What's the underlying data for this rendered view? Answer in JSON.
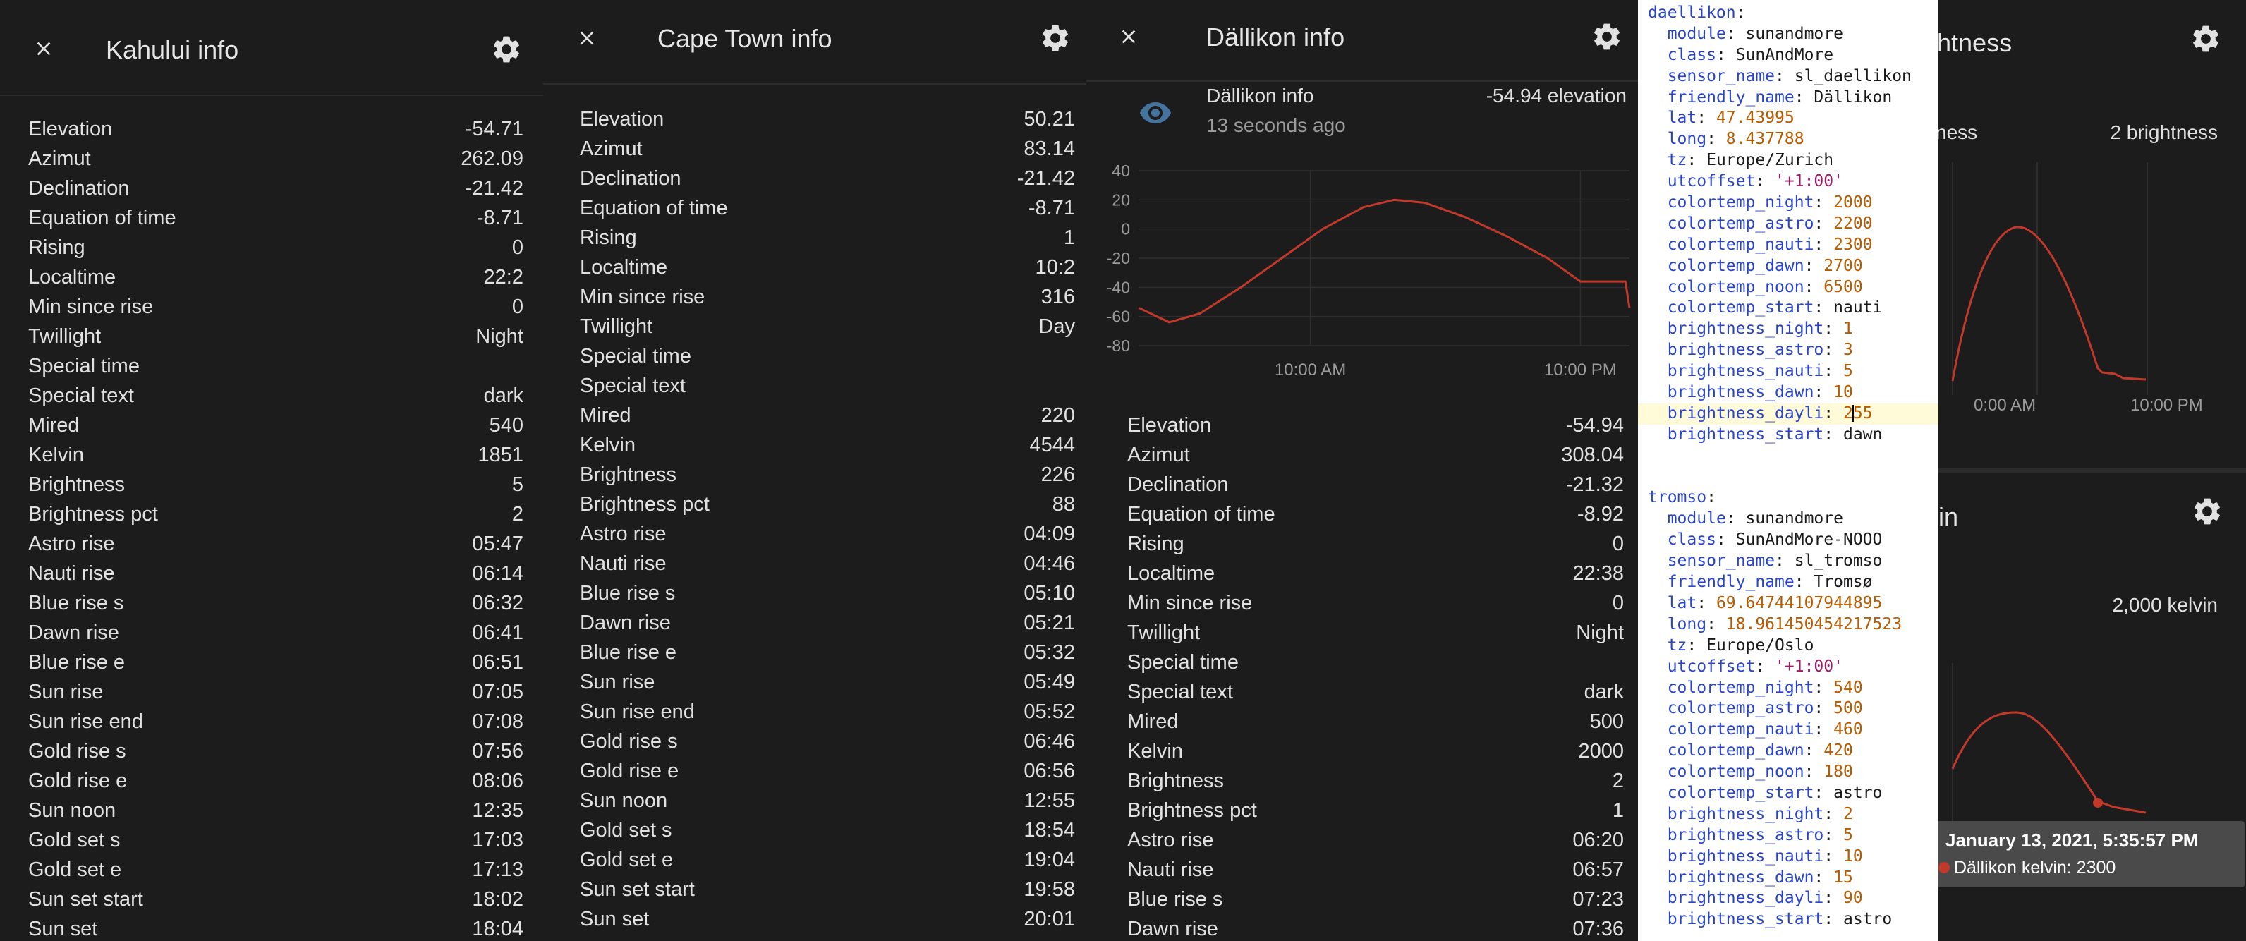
{
  "kahului": {
    "title": "Kahului info",
    "rows": [
      {
        "label": "Elevation",
        "value": "-54.71"
      },
      {
        "label": "Azimut",
        "value": "262.09"
      },
      {
        "label": "Declination",
        "value": "-21.42"
      },
      {
        "label": "Equation of time",
        "value": "-8.71"
      },
      {
        "label": "Rising",
        "value": "0"
      },
      {
        "label": "Localtime",
        "value": "22:2"
      },
      {
        "label": "Min since rise",
        "value": "0"
      },
      {
        "label": "Twillight",
        "value": "Night"
      },
      {
        "label": "Special time",
        "value": ""
      },
      {
        "label": "Special text",
        "value": "dark"
      },
      {
        "label": "Mired",
        "value": "540"
      },
      {
        "label": "Kelvin",
        "value": "1851"
      },
      {
        "label": "Brightness",
        "value": "5"
      },
      {
        "label": "Brightness pct",
        "value": "2"
      },
      {
        "label": "Astro rise",
        "value": "05:47"
      },
      {
        "label": "Nauti rise",
        "value": "06:14"
      },
      {
        "label": "Blue rise s",
        "value": "06:32"
      },
      {
        "label": "Dawn rise",
        "value": "06:41"
      },
      {
        "label": "Blue rise e",
        "value": "06:51"
      },
      {
        "label": "Sun rise",
        "value": "07:05"
      },
      {
        "label": "Sun rise end",
        "value": "07:08"
      },
      {
        "label": "Gold rise s",
        "value": "07:56"
      },
      {
        "label": "Gold rise e",
        "value": "08:06"
      },
      {
        "label": "Sun noon",
        "value": "12:35"
      },
      {
        "label": "Gold set s",
        "value": "17:03"
      },
      {
        "label": "Gold set e",
        "value": "17:13"
      },
      {
        "label": "Sun set start",
        "value": "18:02"
      },
      {
        "label": "Sun set",
        "value": "18:04"
      }
    ]
  },
  "capetown": {
    "title": "Cape Town info",
    "rows": [
      {
        "label": "Elevation",
        "value": "50.21"
      },
      {
        "label": "Azimut",
        "value": "83.14"
      },
      {
        "label": "Declination",
        "value": "-21.42"
      },
      {
        "label": "Equation of time",
        "value": "-8.71"
      },
      {
        "label": "Rising",
        "value": "1"
      },
      {
        "label": "Localtime",
        "value": "10:2"
      },
      {
        "label": "Min since rise",
        "value": "316"
      },
      {
        "label": "Twillight",
        "value": "Day"
      },
      {
        "label": "Special time",
        "value": ""
      },
      {
        "label": "Special text",
        "value": ""
      },
      {
        "label": "Mired",
        "value": "220"
      },
      {
        "label": "Kelvin",
        "value": "4544"
      },
      {
        "label": "Brightness",
        "value": "226"
      },
      {
        "label": "Brightness pct",
        "value": "88"
      },
      {
        "label": "Astro rise",
        "value": "04:09"
      },
      {
        "label": "Nauti rise",
        "value": "04:46"
      },
      {
        "label": "Blue rise s",
        "value": "05:10"
      },
      {
        "label": "Dawn rise",
        "value": "05:21"
      },
      {
        "label": "Blue rise e",
        "value": "05:32"
      },
      {
        "label": "Sun rise",
        "value": "05:49"
      },
      {
        "label": "Sun rise end",
        "value": "05:52"
      },
      {
        "label": "Gold rise s",
        "value": "06:46"
      },
      {
        "label": "Gold rise e",
        "value": "06:56"
      },
      {
        "label": "Sun noon",
        "value": "12:55"
      },
      {
        "label": "Gold set s",
        "value": "18:54"
      },
      {
        "label": "Gold set e",
        "value": "19:04"
      },
      {
        "label": "Sun set start",
        "value": "19:58"
      },
      {
        "label": "Sun set",
        "value": "20:01"
      }
    ]
  },
  "dallikon": {
    "title": "Dällikon info",
    "history": {
      "entity_name": "Dällikon info",
      "state": "-54.94 elevation",
      "last_changed": "13 seconds ago"
    },
    "rows": [
      {
        "label": "Elevation",
        "value": "-54.94"
      },
      {
        "label": "Azimut",
        "value": "308.04"
      },
      {
        "label": "Declination",
        "value": "-21.32"
      },
      {
        "label": "Equation of time",
        "value": "-8.92"
      },
      {
        "label": "Rising",
        "value": "0"
      },
      {
        "label": "Localtime",
        "value": "22:38"
      },
      {
        "label": "Min since rise",
        "value": "0"
      },
      {
        "label": "Twillight",
        "value": "Night"
      },
      {
        "label": "Special time",
        "value": ""
      },
      {
        "label": "Special text",
        "value": "dark"
      },
      {
        "label": "Mired",
        "value": "500"
      },
      {
        "label": "Kelvin",
        "value": "2000"
      },
      {
        "label": "Brightness",
        "value": "2"
      },
      {
        "label": "Brightness pct",
        "value": "1"
      },
      {
        "label": "Astro rise",
        "value": "06:20"
      },
      {
        "label": "Nauti rise",
        "value": "06:57"
      },
      {
        "label": "Blue rise s",
        "value": "07:23"
      },
      {
        "label": "Dawn rise",
        "value": "07:36"
      }
    ]
  },
  "yaml": {
    "lines": [
      {
        "indent": 0,
        "key": "daellikon",
        "value": "",
        "vtype": "plain"
      },
      {
        "indent": 1,
        "key": "module",
        "value": "sunandmore",
        "vtype": "plain"
      },
      {
        "indent": 1,
        "key": "class",
        "value": "SunAndMore",
        "vtype": "plain"
      },
      {
        "indent": 1,
        "key": "sensor_name",
        "value": "sl_daellikon",
        "vtype": "plain"
      },
      {
        "indent": 1,
        "key": "friendly_name",
        "value": "Dällikon",
        "vtype": "plain"
      },
      {
        "indent": 1,
        "key": "lat",
        "value": "47.43995",
        "vtype": "number"
      },
      {
        "indent": 1,
        "key": "long",
        "value": "8.437788",
        "vtype": "number"
      },
      {
        "indent": 1,
        "key": "tz",
        "value": "Europe/Zurich",
        "vtype": "plain"
      },
      {
        "indent": 1,
        "key": "utcoffset",
        "value": "'+1:00'",
        "vtype": "string"
      },
      {
        "indent": 1,
        "key": "colortemp_night",
        "value": "2000",
        "vtype": "number"
      },
      {
        "indent": 1,
        "key": "colortemp_astro",
        "value": "2200",
        "vtype": "number"
      },
      {
        "indent": 1,
        "key": "colortemp_nauti",
        "value": "2300",
        "vtype": "number"
      },
      {
        "indent": 1,
        "key": "colortemp_dawn",
        "value": "2700",
        "vtype": "number"
      },
      {
        "indent": 1,
        "key": "colortemp_noon",
        "value": "6500",
        "vtype": "number"
      },
      {
        "indent": 1,
        "key": "colortemp_start",
        "value": "nauti",
        "vtype": "plain"
      },
      {
        "indent": 1,
        "key": "brightness_night",
        "value": "1",
        "vtype": "number"
      },
      {
        "indent": 1,
        "key": "brightness_astro",
        "value": "3",
        "vtype": "number"
      },
      {
        "indent": 1,
        "key": "brightness_nauti",
        "value": "5",
        "vtype": "number"
      },
      {
        "indent": 1,
        "key": "brightness_dawn",
        "value": "10",
        "vtype": "number"
      },
      {
        "indent": 1,
        "key": "brightness_dayli",
        "value": "255",
        "vtype": "number",
        "highlight": true
      },
      {
        "indent": 1,
        "key": "brightness_start",
        "value": "dawn",
        "vtype": "plain"
      },
      {
        "indent": 0,
        "key": "",
        "value": "",
        "vtype": "blank"
      },
      {
        "indent": 0,
        "key": "",
        "value": "",
        "vtype": "blank"
      },
      {
        "indent": 0,
        "key": "tromso",
        "value": "",
        "vtype": "plain"
      },
      {
        "indent": 1,
        "key": "module",
        "value": "sunandmore",
        "vtype": "plain"
      },
      {
        "indent": 1,
        "key": "class",
        "value": "SunAndMore-NOOO",
        "vtype": "plain"
      },
      {
        "indent": 1,
        "key": "sensor_name",
        "value": "sl_tromso",
        "vtype": "plain"
      },
      {
        "indent": 1,
        "key": "friendly_name",
        "value": "Tromsø",
        "vtype": "plain"
      },
      {
        "indent": 1,
        "key": "lat",
        "value": "69.64744107944895",
        "vtype": "number"
      },
      {
        "indent": 1,
        "key": "long",
        "value": "18.961450454217523",
        "vtype": "number"
      },
      {
        "indent": 1,
        "key": "tz",
        "value": "Europe/Oslo",
        "vtype": "plain"
      },
      {
        "indent": 1,
        "key": "utcoffset",
        "value": "'+1:00'",
        "vtype": "string"
      },
      {
        "indent": 1,
        "key": "colortemp_night",
        "value": "540",
        "vtype": "number"
      },
      {
        "indent": 1,
        "key": "colortemp_astro",
        "value": "500",
        "vtype": "number"
      },
      {
        "indent": 1,
        "key": "colortemp_nauti",
        "value": "460",
        "vtype": "number"
      },
      {
        "indent": 1,
        "key": "colortemp_dawn",
        "value": "420",
        "vtype": "number"
      },
      {
        "indent": 1,
        "key": "colortemp_noon",
        "value": "180",
        "vtype": "number"
      },
      {
        "indent": 1,
        "key": "colortemp_start",
        "value": "astro",
        "vtype": "plain"
      },
      {
        "indent": 1,
        "key": "brightness_night",
        "value": "2",
        "vtype": "number"
      },
      {
        "indent": 1,
        "key": "brightness_astro",
        "value": "5",
        "vtype": "number"
      },
      {
        "indent": 1,
        "key": "brightness_nauti",
        "value": "10",
        "vtype": "number"
      },
      {
        "indent": 1,
        "key": "brightness_dawn",
        "value": "15",
        "vtype": "number"
      },
      {
        "indent": 1,
        "key": "brightness_dayli",
        "value": "90",
        "vtype": "number"
      },
      {
        "indent": 1,
        "key": "brightness_start",
        "value": "astro",
        "vtype": "plain"
      }
    ]
  },
  "right": {
    "top_title_fragment": "htness",
    "top_state": "2 brightness",
    "top_legend_fragment": "ness",
    "top_xticks": [
      "0:00 AM",
      "10:00 PM"
    ],
    "bottom_title_fragment": "in",
    "bottom_state": "2,000 kelvin",
    "tooltip_date": "January 13, 2021, 5:35:57 PM",
    "tooltip_value": "Dällikon kelvin: 2300"
  },
  "colors": {
    "background": "#1c1c1c",
    "line": "#c0392b",
    "icon": "#e1e1e1",
    "history_icon": "#44739e",
    "muted_text": "#9b9b9b",
    "grid": "#2e2e2e",
    "yaml_key": "#2944c8",
    "yaml_number": "#b75b00",
    "yaml_string": "#9c1a6a"
  },
  "chart_data": [
    {
      "type": "line",
      "series": [
        {
          "values": [
            [
              0,
              -54
            ],
            [
              1.5,
              -64
            ],
            [
              3,
              -58
            ],
            [
              5,
              -40
            ],
            [
              7,
              -20
            ],
            [
              9,
              0
            ],
            [
              11,
              15
            ],
            [
              12.5,
              20
            ],
            [
              14,
              18
            ],
            [
              16,
              8
            ],
            [
              18,
              -5
            ],
            [
              20,
              -20
            ],
            [
              21.6,
              -36
            ],
            [
              22.5,
              -36
            ],
            [
              23.8,
              -36
            ],
            [
              24,
              -54
            ]
          ]
        }
      ],
      "xticks": [
        "10:00 AM",
        "10:00 PM"
      ],
      "yticks": [
        40,
        20,
        0,
        -20,
        -40,
        -60,
        -80
      ],
      "ylim": [
        -80,
        40
      ],
      "grid": true
    }
  ]
}
